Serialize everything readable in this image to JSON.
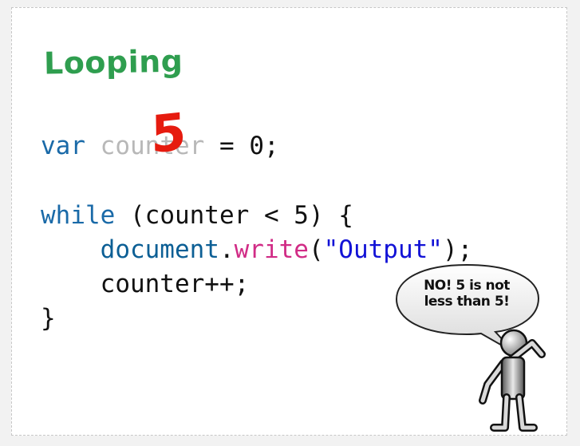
{
  "slide": {
    "title": "Looping",
    "code": {
      "line1": {
        "keyword": "var",
        "identifier": "counter",
        "assignment": " = 0;"
      },
      "line3": {
        "keyword": "while",
        "rest": " (counter < 5) {"
      },
      "line4": {
        "indent": "    ",
        "object": "document",
        "dot": ".",
        "method": "write",
        "open": "(",
        "string": "\"Output\"",
        "close": ");"
      },
      "line5": {
        "text": "    counter++;"
      },
      "line6": {
        "text": "}"
      }
    },
    "overlay_value": "5",
    "speech_bubble": {
      "line1": "NO! 5 is not",
      "line2": "less than 5!"
    }
  },
  "colors": {
    "title": "#2f9e4f",
    "keyword": "#1a6aa8",
    "method": "#d12c86",
    "string": "#1212d6",
    "overlay": "#e61b0f"
  }
}
